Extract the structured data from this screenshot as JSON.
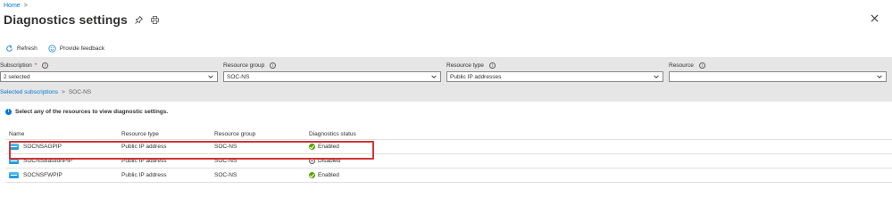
{
  "breadcrumb": {
    "home": "Home",
    "separator": ">"
  },
  "page": {
    "title": "Diagnostics settings"
  },
  "toolbar": {
    "refresh_label": "Refresh",
    "feedback_label": "Provide feedback"
  },
  "filters": {
    "subscription": {
      "label": "Subscription",
      "required_mark": "*",
      "value": "2 selected"
    },
    "resource_group": {
      "label": "Resource group",
      "value": "SOC-NS"
    },
    "resource_type": {
      "label": "Resource type",
      "value": "Public IP addresses"
    },
    "resource": {
      "label": "Resource",
      "value": ""
    },
    "info_glyph": "i"
  },
  "scope_crumb": {
    "link": "Selected subscriptions",
    "separator": ">",
    "current": "SOC-NS"
  },
  "notice": {
    "icon": "i",
    "text": "Select any of the resources to view diagnostic settings."
  },
  "table": {
    "headers": [
      "Name",
      "Resource type",
      "Resource group",
      "Diagnostics status"
    ],
    "rows": [
      {
        "name": "SOCNSAGPIP",
        "type": "Public IP address",
        "group": "SOC-NS",
        "status": "Enabled",
        "status_kind": "enabled"
      },
      {
        "name": "SOCNSBastionPIP",
        "type": "Public IP address",
        "group": "SOC-NS",
        "status": "Disabled",
        "status_kind": "disabled"
      },
      {
        "name": "SOCNSFWPIP",
        "type": "Public IP address",
        "group": "SOC-NS",
        "status": "Enabled",
        "status_kind": "enabled"
      }
    ]
  },
  "colors": {
    "accent": "#0078d4",
    "highlight": "#d13438",
    "enabled": "#57a300",
    "panel_bg": "#e6e6e6"
  }
}
